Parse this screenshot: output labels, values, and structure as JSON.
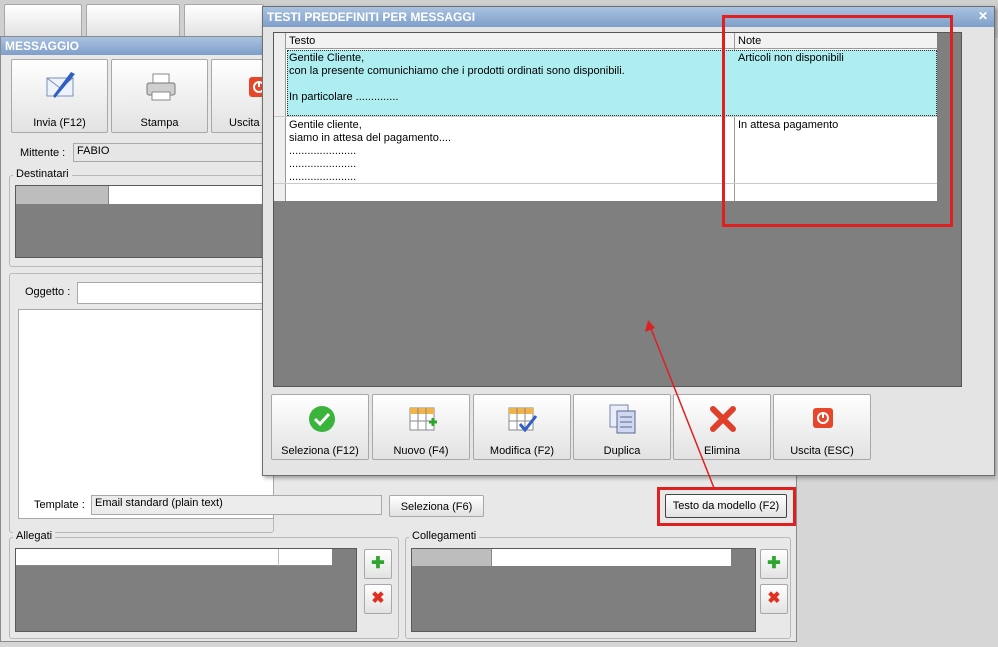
{
  "background_window": {
    "title": "MESSAGGIO",
    "toolbar": [
      {
        "label": "Invia (F12)",
        "icon": "send-mail-icon"
      },
      {
        "label": "Stampa",
        "icon": "printer-icon"
      },
      {
        "label": "Uscita",
        "icon": "exit-icon"
      }
    ],
    "mittente_label": "Mittente :",
    "mittente_value": "FABIO",
    "destinatari_label": "Destinatari",
    "oggetto_label": "Oggetto :",
    "template_label": "Template :",
    "template_value": "Email standard (plain text)",
    "seleziona_button": "Seleziona (F6)",
    "testo_modello_button": "Testo da modello (F2)",
    "allegati_label": "Allegati",
    "collegamenti_label": "Collegamenti"
  },
  "dialog": {
    "title": "TESTI PREDEFINITI PER MESSAGGI",
    "close_glyph": "✕",
    "columns": [
      "Testo",
      "Note"
    ],
    "rows": [
      {
        "testo": "Gentile Cliente,\ncon la presente comunichiamo che i prodotti ordinati sono disponibili.\n\nIn particolare ..............",
        "note": "Articoli non disponibili",
        "selected": true
      },
      {
        "testo": "Gentile cliente,\nsiamo in attesa del pagamento....\n......................\n......................\n......................",
        "note": "In attesa pagamento",
        "selected": false
      }
    ],
    "buttons": [
      {
        "label": "Seleziona (F12)",
        "icon": "check-icon"
      },
      {
        "label": "Nuovo (F4)",
        "icon": "new-row-icon"
      },
      {
        "label": "Modifica (F2)",
        "icon": "edit-grid-icon"
      },
      {
        "label": "Duplica",
        "icon": "duplicate-icon"
      },
      {
        "label": "Elimina",
        "icon": "delete-icon"
      },
      {
        "label": "Uscita (ESC)",
        "icon": "exit-icon"
      }
    ]
  },
  "colors": {
    "selected_row": "#aeeef0",
    "highlight": "#e02020",
    "titlebar": "#8eaad2"
  }
}
